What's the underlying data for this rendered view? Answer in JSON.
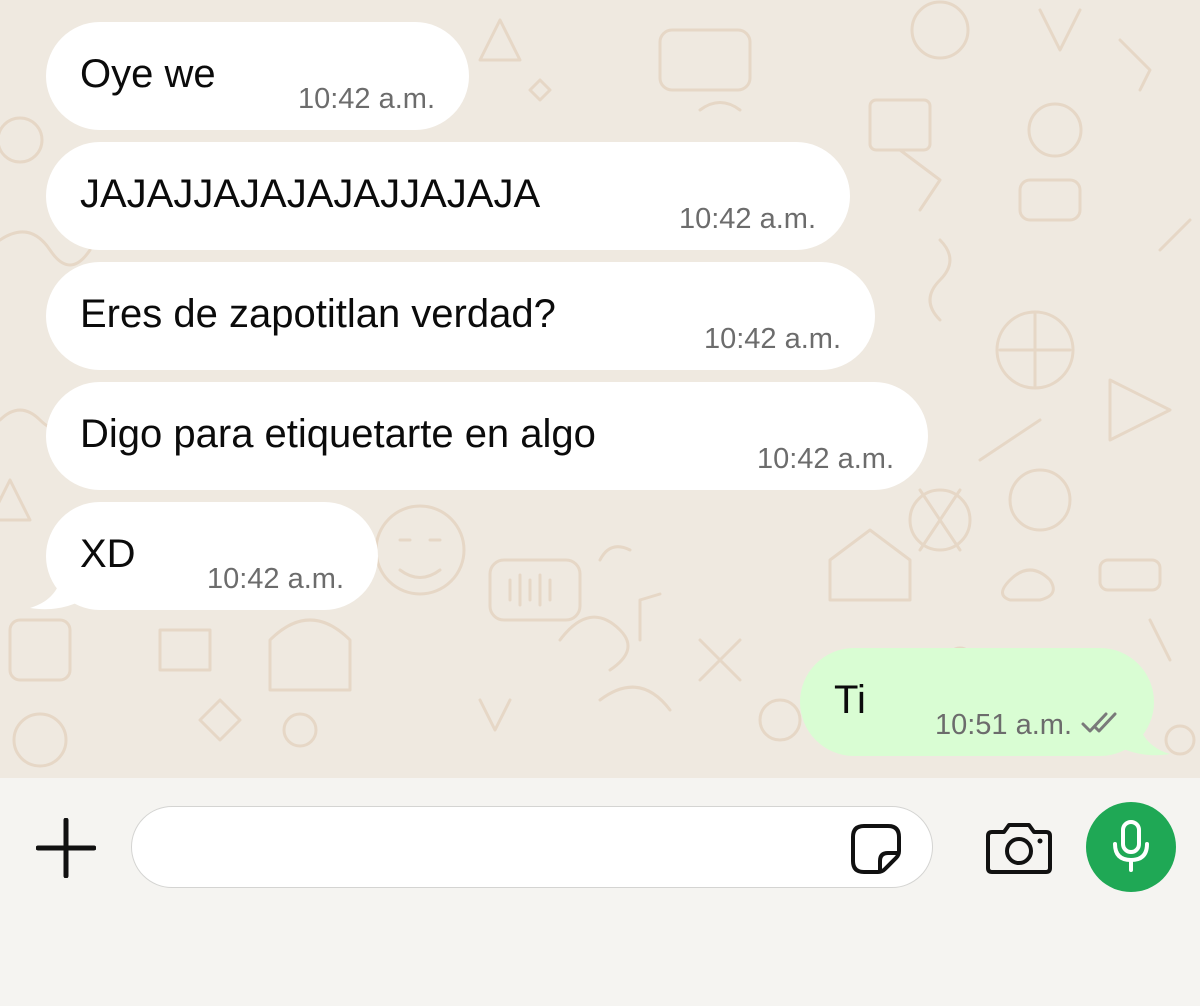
{
  "conversation": {
    "messages": [
      {
        "direction": "incoming",
        "text": "Oye we",
        "time": "10:42 a.m."
      },
      {
        "direction": "incoming",
        "text": "JAJAJJAJAJAJAJJAJAJA",
        "time": "10:42 a.m."
      },
      {
        "direction": "incoming",
        "text": "Eres de zapotitlan verdad?",
        "time": "10:42 a.m."
      },
      {
        "direction": "incoming",
        "text": "Digo para etiquetarte en algo",
        "time": "10:42 a.m."
      },
      {
        "direction": "incoming",
        "text": "XD",
        "time": "10:42 a.m."
      },
      {
        "direction": "outgoing",
        "text": "Ti",
        "time": "10:51 a.m.",
        "status_icon": "double-check-icon"
      }
    ]
  },
  "composer": {
    "input_value": "",
    "icons": [
      "plus-icon",
      "sticker-icon",
      "camera-icon",
      "microphone-icon"
    ]
  },
  "colors": {
    "chat_background": "#efe9e0",
    "incoming_bubble": "#ffffff",
    "outgoing_bubble": "#d9fdd3",
    "mic_button": "#1fa855"
  }
}
